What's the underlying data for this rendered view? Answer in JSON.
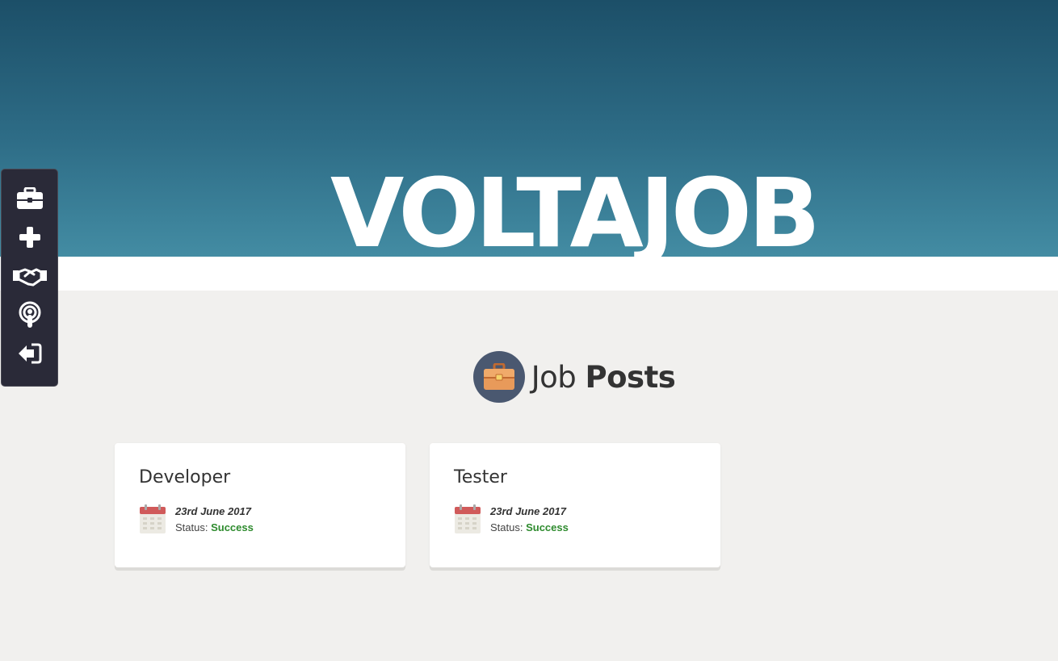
{
  "brand": {
    "title": "VOLTAJOB"
  },
  "nav": {
    "items": [
      {
        "icon": "briefcase-icon"
      },
      {
        "icon": "plus-icon"
      },
      {
        "icon": "handshake-icon"
      },
      {
        "icon": "podcast-icon"
      },
      {
        "icon": "sign-in-icon"
      }
    ]
  },
  "section": {
    "title_light": "Job",
    "title_bold": "Posts",
    "icon": "briefcase-icon"
  },
  "jobs": [
    {
      "title": "Developer",
      "date": "23rd June 2017",
      "status_label": "Status:",
      "status": "Success"
    },
    {
      "title": "Tester",
      "date": "23rd June 2017",
      "status_label": "Status:",
      "status": "Success"
    }
  ],
  "colors": {
    "hero_top": "#1c4f68",
    "hero_bottom": "#438ca3",
    "nav_bg": "#2a2a38",
    "success": "#2e8b2e",
    "page_bg": "#f1f0ee"
  }
}
